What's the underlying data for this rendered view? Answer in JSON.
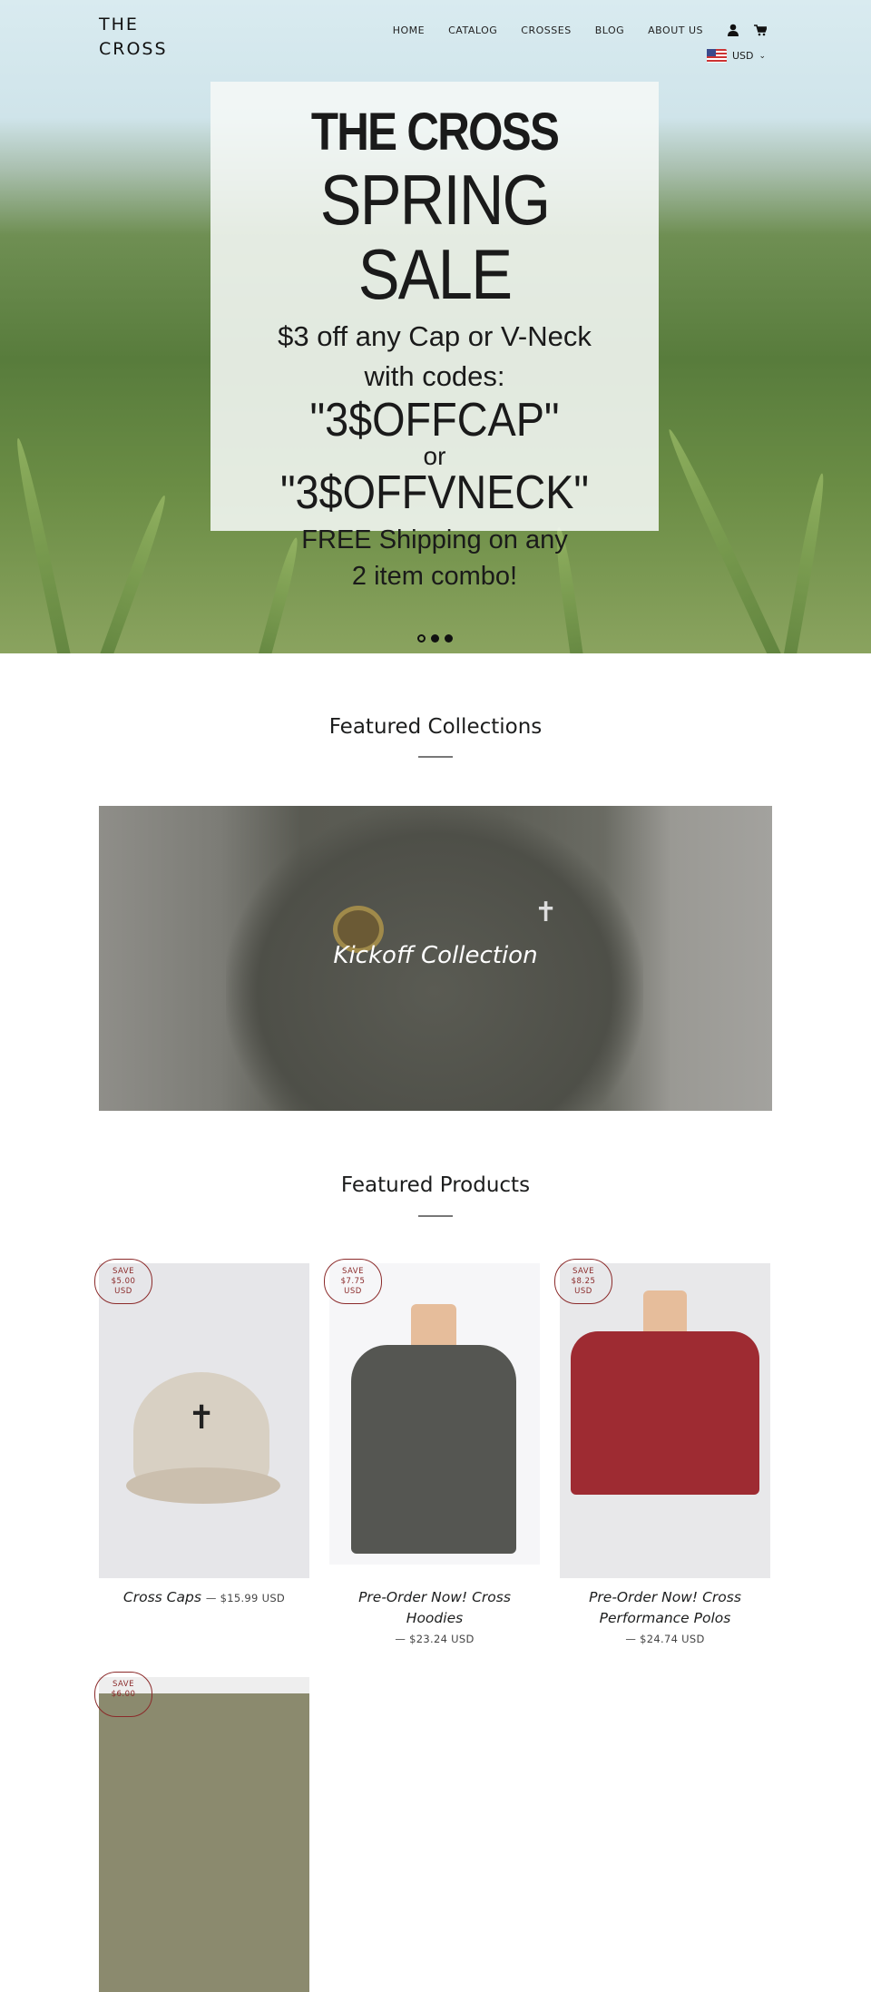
{
  "header": {
    "logo_line1": "THE",
    "logo_line2": "CROSS",
    "nav": [
      "HOME",
      "CATALOG",
      "CROSSES",
      "BLOG",
      "ABOUT US"
    ],
    "currency": "USD"
  },
  "hero": {
    "lines": [
      "THE CROSS",
      "SPRING SALE",
      "$3 off any Cap or V-Neck",
      "with codes:",
      "\"3$OFFCAP\"",
      "or",
      "\"3$OFFVNECK\"",
      "FREE Shipping on any",
      "2 item combo!"
    ],
    "slides": 3,
    "active_slide": 1
  },
  "featured_collections": {
    "title": "Featured Collections",
    "items": [
      {
        "name": "Kickoff Collection"
      }
    ]
  },
  "featured_products": {
    "title": "Featured Products",
    "items": [
      {
        "badge": [
          "SAVE",
          "$5.00",
          "USD"
        ],
        "title": "Cross Caps",
        "price": "$15.99 USD"
      },
      {
        "badge": [
          "SAVE",
          "$7.75",
          "USD"
        ],
        "title": "Pre-Order Now! Cross Hoodies",
        "price": "$23.24 USD"
      },
      {
        "badge": [
          "SAVE",
          "$8.25",
          "USD"
        ],
        "title": "Pre-Order Now! Cross Performance Polos",
        "price": "$24.74 USD"
      },
      {
        "badge": [
          "SAVE",
          "$6.00"
        ]
      }
    ]
  },
  "colors": {
    "badge": "#8b2a2a",
    "text": "#1c1d1d"
  }
}
